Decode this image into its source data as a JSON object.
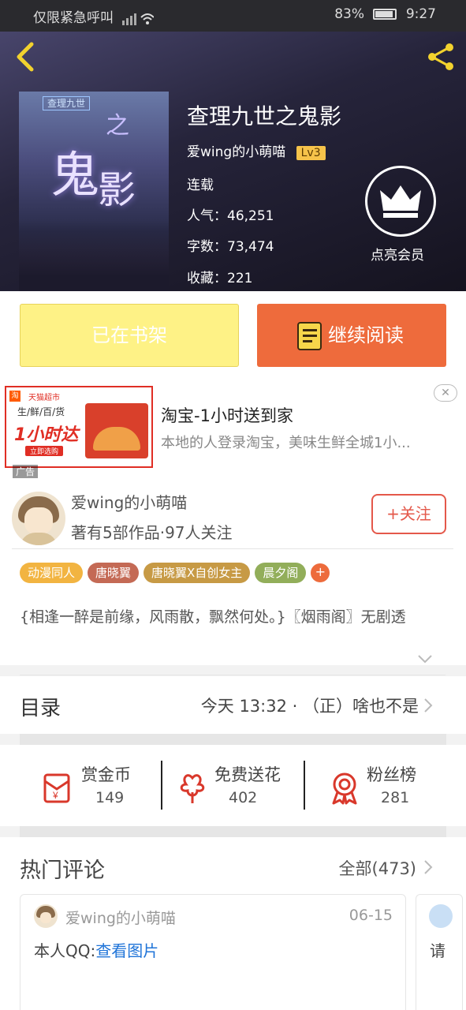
{
  "status_bar": {
    "carrier": "仅限紧急呼叫",
    "battery": "83%",
    "time": "9:27"
  },
  "book": {
    "title": "查理九世之鬼影",
    "author": "爱wing的小萌喵",
    "author_level": "Lv3",
    "status": "连载",
    "popularity_label": "人气：",
    "popularity": "46,251",
    "words_label": "字数：",
    "words": "73,474",
    "favorites_label": "收藏：",
    "favorites": "221",
    "cover": {
      "badge": "查理九世",
      "char_gui": "鬼",
      "char_ying": "影",
      "char_zhi": "之"
    }
  },
  "vip": {
    "label": "点亮会员",
    "icon": "crown-icon"
  },
  "actions": {
    "shelf_label": "已在书架",
    "read_label": "继续阅读"
  },
  "ad": {
    "image": {
      "logo": "淘",
      "store": "天猫超市",
      "category": "生/鲜/百/货",
      "headline": "1小时达",
      "cta": "立即选购"
    },
    "badge": "广告",
    "title": "淘宝-1小时送到家",
    "description": "本地的人登录淘宝，美味生鲜全城1小...",
    "close": "✕"
  },
  "author_card": {
    "name": "爱wing的小萌喵",
    "meta": "著有5部作品·97人关注",
    "follow_label": "+关注",
    "tags": [
      {
        "label": "动漫同人",
        "color": "#f2b441"
      },
      {
        "label": "唐晓翼",
        "color": "#c46a55"
      },
      {
        "label": "唐晓翼X自创女主",
        "color": "#c79a45"
      },
      {
        "label": "晨夕阁",
        "color": "#92ae5a"
      }
    ],
    "tag_more": "+",
    "description": "{相逢一醉是前缘，风雨散，飘然何处。}〖烟雨阁〗无剧透"
  },
  "catalog": {
    "title": "目录",
    "latest": "今天 13:32 · （正）啥也不是"
  },
  "stats": [
    {
      "label": "赏金币",
      "value": "149",
      "icon": "red-envelope-icon"
    },
    {
      "label": "免费送花",
      "value": "402",
      "icon": "flower-icon"
    },
    {
      "label": "粉丝榜",
      "value": "281",
      "icon": "medal-icon"
    }
  ],
  "comments": {
    "title": "热门评论",
    "all_label": "全部(473)",
    "items": [
      {
        "user": "爱wing的小萌喵",
        "date": "06-15",
        "text_prefix": "本人QQ:",
        "link": "查看图片"
      },
      {
        "text_prefix": "请"
      }
    ]
  },
  "colors": {
    "accent": "#ee6b3c",
    "shelf": "#fef286",
    "follow": "#e4584a",
    "link": "#1f74d8"
  }
}
